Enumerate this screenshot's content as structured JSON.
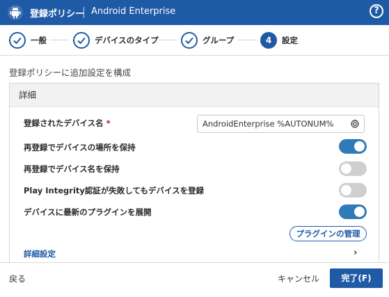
{
  "header": {
    "title": "登録ポリシー",
    "subtitle": "Android Enterprise",
    "help_icon": "help-icon",
    "help_glyph": "?",
    "bg_color": "#1f5aa6"
  },
  "steps": [
    {
      "label": "一般",
      "state": "done"
    },
    {
      "label": "デバイスのタイプ",
      "state": "done"
    },
    {
      "label": "グループ",
      "state": "done"
    },
    {
      "label": "設定",
      "state": "active",
      "number": "4"
    }
  ],
  "intro": "登録ポリシーに追加設定を構成",
  "panel": {
    "title": "詳細",
    "device_name_label": "登録されたデバイス名",
    "required_mark": "*",
    "device_name_value": "AndroidEnterprise %AUTONUM%",
    "toggles": [
      {
        "label": "再登録でデバイスの場所を保持",
        "on": true
      },
      {
        "label": "再登録でデバイス名を保持",
        "on": false
      },
      {
        "label": "Play Integrity認証が失敗してもデバイスを登録",
        "on": false
      },
      {
        "label": "デバイスに最新のプラグインを展開",
        "on": true
      }
    ],
    "plugin_button": "プラグインの管理",
    "advanced_label": "詳細設定",
    "advanced_chevron": "›"
  },
  "footer": {
    "back": "戻る",
    "cancel": "キャンセル",
    "finish": "完了(F)"
  }
}
